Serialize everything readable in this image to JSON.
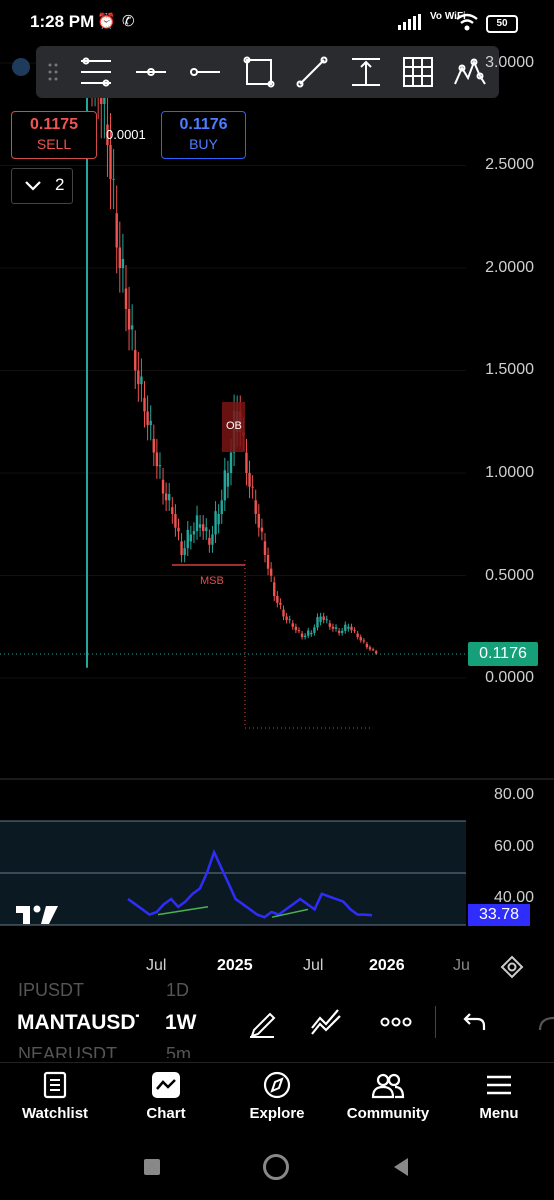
{
  "status_bar": {
    "time": "1:28 PM",
    "network": "Vo WiFi",
    "battery": "50"
  },
  "trade": {
    "sell_price": "0.1175",
    "sell_label": "SELL",
    "buy_price": "0.1176",
    "buy_label": "BUY",
    "spread": "0.0001"
  },
  "collapse_count": "2",
  "price_axis": [
    "3.0000",
    "2.5000",
    "2.0000",
    "1.5000",
    "1.0000",
    "0.5000",
    "0.0000"
  ],
  "current_price": "0.1176",
  "annotations": {
    "order_block": "OB",
    "structure_break": "MSB"
  },
  "rsi_axis": [
    "80.00",
    "60.00",
    "40.00"
  ],
  "rsi_value": "33.78",
  "time_axis": [
    "Jul",
    "2025",
    "Jul",
    "2026",
    "Ju"
  ],
  "symbols": {
    "prev": "IPUSDT",
    "prev_tf": "1D",
    "current": "MANTAUSDT",
    "current_tf": "1W",
    "next": "NEARUSDT",
    "next_tf": "5m"
  },
  "nav": [
    {
      "label": "Watchlist",
      "icon": "watchlist-icon"
    },
    {
      "label": "Chart",
      "icon": "chart-icon"
    },
    {
      "label": "Explore",
      "icon": "compass-icon"
    },
    {
      "label": "Community",
      "icon": "community-icon"
    },
    {
      "label": "Menu",
      "icon": "menu-icon"
    }
  ],
  "colors": {
    "up": "#26a69a",
    "down": "#ef5350",
    "rsi": "#2f2dfb",
    "background": "#000000"
  },
  "chart_data": {
    "type": "candlestick",
    "symbol": "MANTAUSDT",
    "timeframe": "1W",
    "ylim": [
      0,
      3.0
    ],
    "last_price": 0.1176,
    "series_close_approx": [
      2.9,
      2.6,
      2.1,
      1.8,
      1.5,
      1.3,
      1.1,
      0.9,
      0.8,
      0.6,
      0.7,
      0.75,
      0.65,
      0.8,
      1.0,
      1.3,
      1.0,
      0.8,
      0.6,
      0.4,
      0.3,
      0.25,
      0.2,
      0.22,
      0.3,
      0.25,
      0.22,
      0.25,
      0.2,
      0.15,
      0.12
    ],
    "rsi": {
      "value": 33.78,
      "levels": [
        70,
        30
      ],
      "ylim": [
        30,
        80
      ]
    }
  }
}
